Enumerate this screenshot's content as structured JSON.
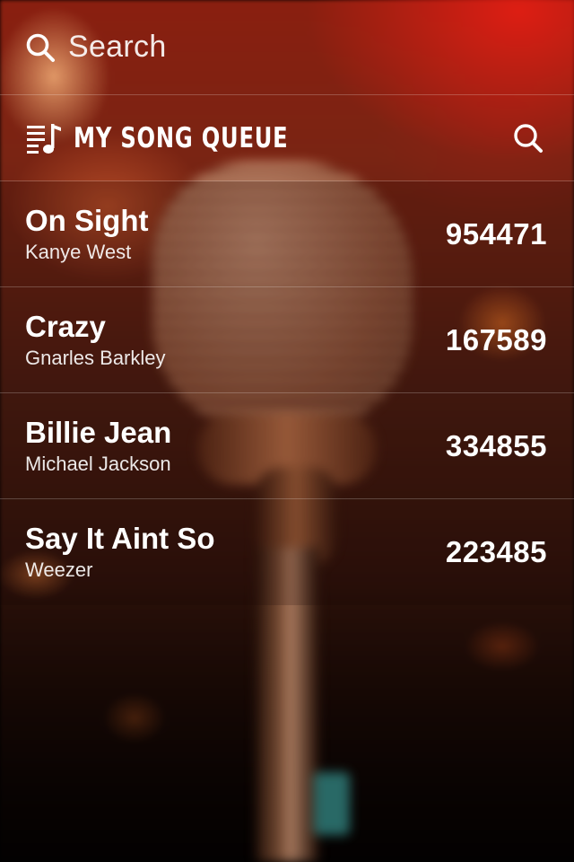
{
  "search": {
    "placeholder": "Search",
    "icon": "search-icon"
  },
  "header": {
    "title": "MY SONG QUEUE",
    "queue_icon": "music-queue-icon",
    "search_icon": "search-icon"
  },
  "songs": [
    {
      "title": "On Sight",
      "artist": "Kanye West",
      "code": "954471"
    },
    {
      "title": "Crazy",
      "artist": "Gnarles Barkley",
      "code": "167589"
    },
    {
      "title": "Billie Jean",
      "artist": "Michael Jackson",
      "code": "334855"
    },
    {
      "title": "Say It Aint So",
      "artist": "Weezer",
      "code": "223485"
    }
  ],
  "colors": {
    "text": "#ffffff",
    "accent_red": "#d81e12",
    "divider": "rgba(255,255,255,0.22)"
  }
}
